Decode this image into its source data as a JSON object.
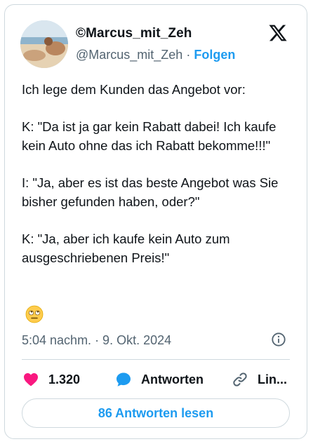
{
  "user": {
    "display_name": "©Marcus_mit_Zeh",
    "handle": "@Marcus_mit_Zeh",
    "separator": " · ",
    "follow_label": "Folgen"
  },
  "tweet": {
    "paragraphs": [
      "Ich lege dem Kunden das Angebot vor:",
      "K: \"Da ist ja gar kein Rabatt dabei! Ich kaufe kein Auto ohne das ich Rabatt bekomme!!!\"",
      "I: \"Ja, aber es ist das beste Angebot was Sie bisher gefunden haben, oder?\"",
      "K: \"Ja, aber ich kaufe kein Auto zum ausgeschriebenen Preis!\""
    ],
    "emoji": "eye-roll-emoji",
    "timestamp": "5:04 nachm. · 9. Okt. 2024"
  },
  "actions": {
    "likes": "1.320",
    "reply_label": "Antworten",
    "link_label": "Lin..."
  },
  "read_replies_label": "86 Antworten lesen",
  "colors": {
    "accent": "#1d9bf0",
    "like": "#f91880",
    "secondary_text": "#536471",
    "border": "#cfd9de"
  },
  "icons": [
    "x-logo-icon",
    "info-icon",
    "heart-icon",
    "reply-bubble-icon",
    "link-icon"
  ]
}
